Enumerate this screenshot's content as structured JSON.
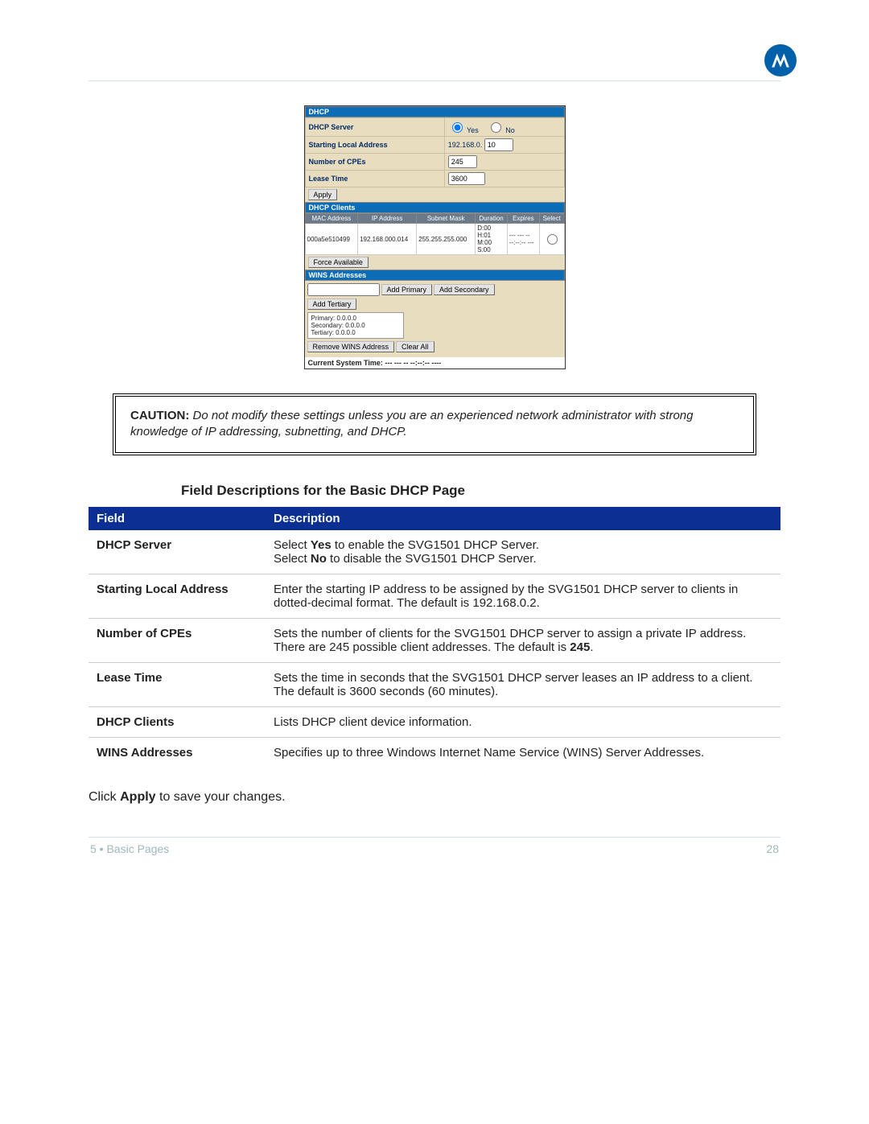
{
  "dhcp_panel": {
    "section_title": "DHCP",
    "rows": {
      "server_label": "DHCP Server",
      "server_yes": "Yes",
      "server_no": "No",
      "start_label": "Starting Local Address",
      "start_prefix": "192.168.0.",
      "start_value": "10",
      "cpes_label": "Number of CPEs",
      "cpes_value": "245",
      "lease_label": "Lease Time",
      "lease_value": "3600"
    },
    "apply_label": "Apply",
    "clients_title": "DHCP Clients",
    "clients_headers": [
      "MAC Address",
      "IP Address",
      "Subnet Mask",
      "Duration",
      "Expires",
      "Select"
    ],
    "client_row": {
      "mac": "000a5e510499",
      "ip": "192.168.000.014",
      "mask": "255.255.255.000",
      "duration": "D:00\nH:01\nM:00\nS:00",
      "expires": "--- --- --\n--:--:-- ---"
    },
    "force_label": "Force Available",
    "wins_title": "WINS Addresses",
    "add_primary": "Add Primary",
    "add_secondary": "Add Secondary",
    "add_tertiary": "Add Tertiary",
    "wins_list": {
      "primary": "Primary:    0.0.0.0",
      "secondary": "Secondary: 0.0.0.0",
      "tertiary": "Tertiary:    0.0.0.0"
    },
    "remove_label": "Remove WINS Address",
    "clear_all": "Clear All",
    "time_line": "Current System Time: --- --- -- --:--:-- ----"
  },
  "caution": {
    "label": "CAUTION:",
    "text": " Do not modify these settings unless you are an experienced network administrator with strong knowledge of IP addressing, subnetting, and DHCP."
  },
  "heading": "Field Descriptions for the Basic DHCP Page",
  "table": {
    "col_field": "Field",
    "col_desc": "Description",
    "rows": [
      {
        "field": "DHCP Server",
        "desc_html": "Select <b>Yes</b> to enable the SVG1501 DHCP Server.<br>Select <b>No</b> to disable the SVG1501 DHCP Server."
      },
      {
        "field": "Starting Local Address",
        "desc_html": "Enter the starting IP address to be assigned by the SVG1501 DHCP server to clients in dotted-decimal format. The default is 192.168.0.2."
      },
      {
        "field": "Number of CPEs",
        "desc_html": "Sets the number of clients for the SVG1501 DHCP server to assign a private IP address. There are 245 possible client addresses. The default is <b>245</b>."
      },
      {
        "field": "Lease Time",
        "desc_html": "Sets the time in seconds that the SVG1501 DHCP server leases an IP address to a client. The default is 3600 seconds (60 minutes)."
      },
      {
        "field": "DHCP Clients",
        "desc_html": "Lists DHCP client device information."
      },
      {
        "field": "WINS Addresses",
        "desc_html": "Specifies up to three Windows Internet Name Service (WINS) Server Addresses."
      }
    ]
  },
  "closing_html": "Click <b>Apply</b> to save your changes.",
  "footer": {
    "left": "5 • Basic Pages",
    "right": "28"
  }
}
